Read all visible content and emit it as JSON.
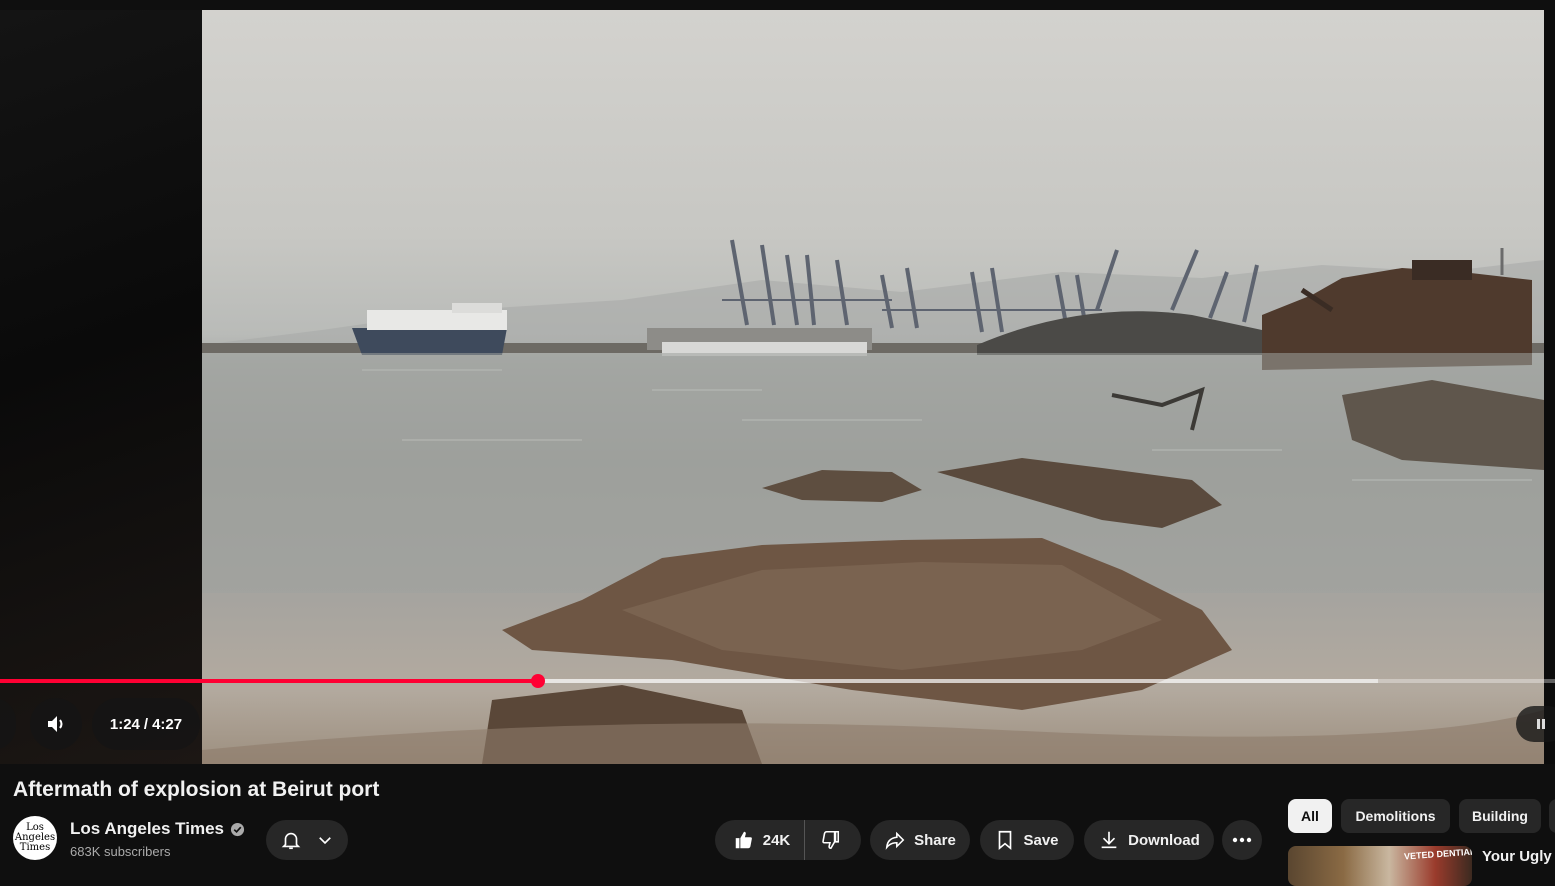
{
  "player": {
    "current_time": "1:24",
    "separator": "/",
    "duration": "4:27",
    "played_fraction": 0.346,
    "buffered_fraction": 0.886
  },
  "video": {
    "title": "Aftermath of explosion at Beirut port"
  },
  "channel": {
    "name": "Los Angeles Times",
    "subscribers": "683K subscribers",
    "avatar_text": "Los Angeles Times",
    "verified": true
  },
  "actions": {
    "likes": "24K",
    "share_label": "Share",
    "save_label": "Save",
    "download_label": "Download"
  },
  "chips": [
    "All",
    "Demolitions",
    "Building",
    ""
  ],
  "recommendation": {
    "title": "Your Ugly C",
    "thumbnail_text": "VETED DENTIAL"
  },
  "colors": {
    "background": "#0f0f0f",
    "accent": "#ff0033",
    "pill": "#272727",
    "secondary_text": "#aaaaaa"
  },
  "icons": [
    "previous-icon",
    "volume-icon",
    "bell-icon",
    "chevron-down-icon",
    "thumbs-up-icon",
    "thumbs-down-icon",
    "share-icon",
    "bookmark-icon",
    "download-icon",
    "more-icon",
    "verified-icon",
    "pause-icon"
  ]
}
